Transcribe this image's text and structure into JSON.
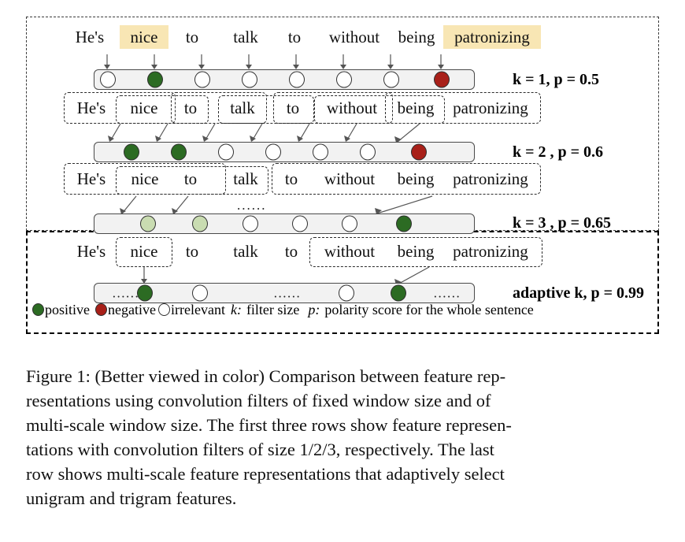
{
  "figure": {
    "sentence_words": [
      "He's",
      "nice",
      "to",
      "talk",
      "to",
      "without",
      "being",
      "patronizing"
    ],
    "highlight_color": "#f8e6b4",
    "colors": {
      "positive": "#2c6b23",
      "negative": "#a82019",
      "irrelevant": "#ffffff",
      "weak_positive": "#c9dcb1",
      "bar_fill": "#f2f2f2",
      "bar_border": "#4a4a4a"
    },
    "rows": [
      {
        "id": "row-unigram",
        "annotation": {
          "k_label": "k",
          "k_value": "= 1,",
          "p_label": "p",
          "p_value": "= 0.5",
          "full": "k = 1,  p = 0.5"
        },
        "cells": [
          {
            "type": "irrelevant"
          },
          {
            "type": "positive"
          },
          {
            "type": "irrelevant"
          },
          {
            "type": "irrelevant"
          },
          {
            "type": "irrelevant"
          },
          {
            "type": "irrelevant"
          },
          {
            "type": "irrelevant"
          },
          {
            "type": "negative"
          }
        ],
        "ellipses": []
      },
      {
        "id": "row-bigram",
        "annotation": {
          "k_label": "k",
          "k_value": "= 2 ,",
          "p_label": "p",
          "p_value": "= 0.6",
          "full": "k = 2 ,  p = 0.6"
        },
        "cells": [
          {
            "type": "positive"
          },
          {
            "type": "positive"
          },
          {
            "type": "irrelevant"
          },
          {
            "type": "irrelevant"
          },
          {
            "type": "irrelevant"
          },
          {
            "type": "irrelevant"
          },
          {
            "type": "negative"
          }
        ],
        "ellipses": []
      },
      {
        "id": "row-trigram",
        "annotation": {
          "k_label": "k",
          "k_value": "= 3 ,",
          "p_label": "p",
          "p_value": "= 0.65",
          "full": "k = 3 ,  p = 0.65"
        },
        "cells": [
          {
            "type": "weak_positive"
          },
          {
            "type": "weak_positive"
          },
          {
            "type": "irrelevant"
          },
          {
            "type": "irrelevant"
          },
          {
            "type": "irrelevant"
          },
          {
            "type": "positive"
          }
        ],
        "ellipses": [
          "......"
        ]
      },
      {
        "id": "row-adaptive",
        "annotation": {
          "k_label": "adaptive k,",
          "k_value": "",
          "p_label": "p",
          "p_value": "= 0.99",
          "full": "adaptive k,  p = 0.99"
        },
        "cells": [
          {
            "type": "positive"
          },
          {
            "type": "irrelevant"
          },
          {
            "type": "irrelevant"
          },
          {
            "type": "positive"
          }
        ],
        "ellipses": [
          "......",
          "......",
          "......"
        ]
      }
    ],
    "legend": {
      "positive": "positive",
      "negative": "negative",
      "irrelevant": "irrelevant",
      "k_symbol": "k:",
      "k_text": "filter size",
      "p_symbol": "p:",
      "p_text": "polarity score for the whole sentence"
    }
  },
  "caption": {
    "line1": "Figure 1: (Better viewed in color) Comparison between feature rep-",
    "line2": "resentations using convolution filters of fixed window size and of",
    "line3": "multi-scale window size. The first three rows show feature represen-",
    "line4": "tations with convolution filters of size 1/2/3, respectively.  The last",
    "line5": "row shows multi-scale feature representations that adaptively select",
    "line6": "unigram and trigram features."
  }
}
